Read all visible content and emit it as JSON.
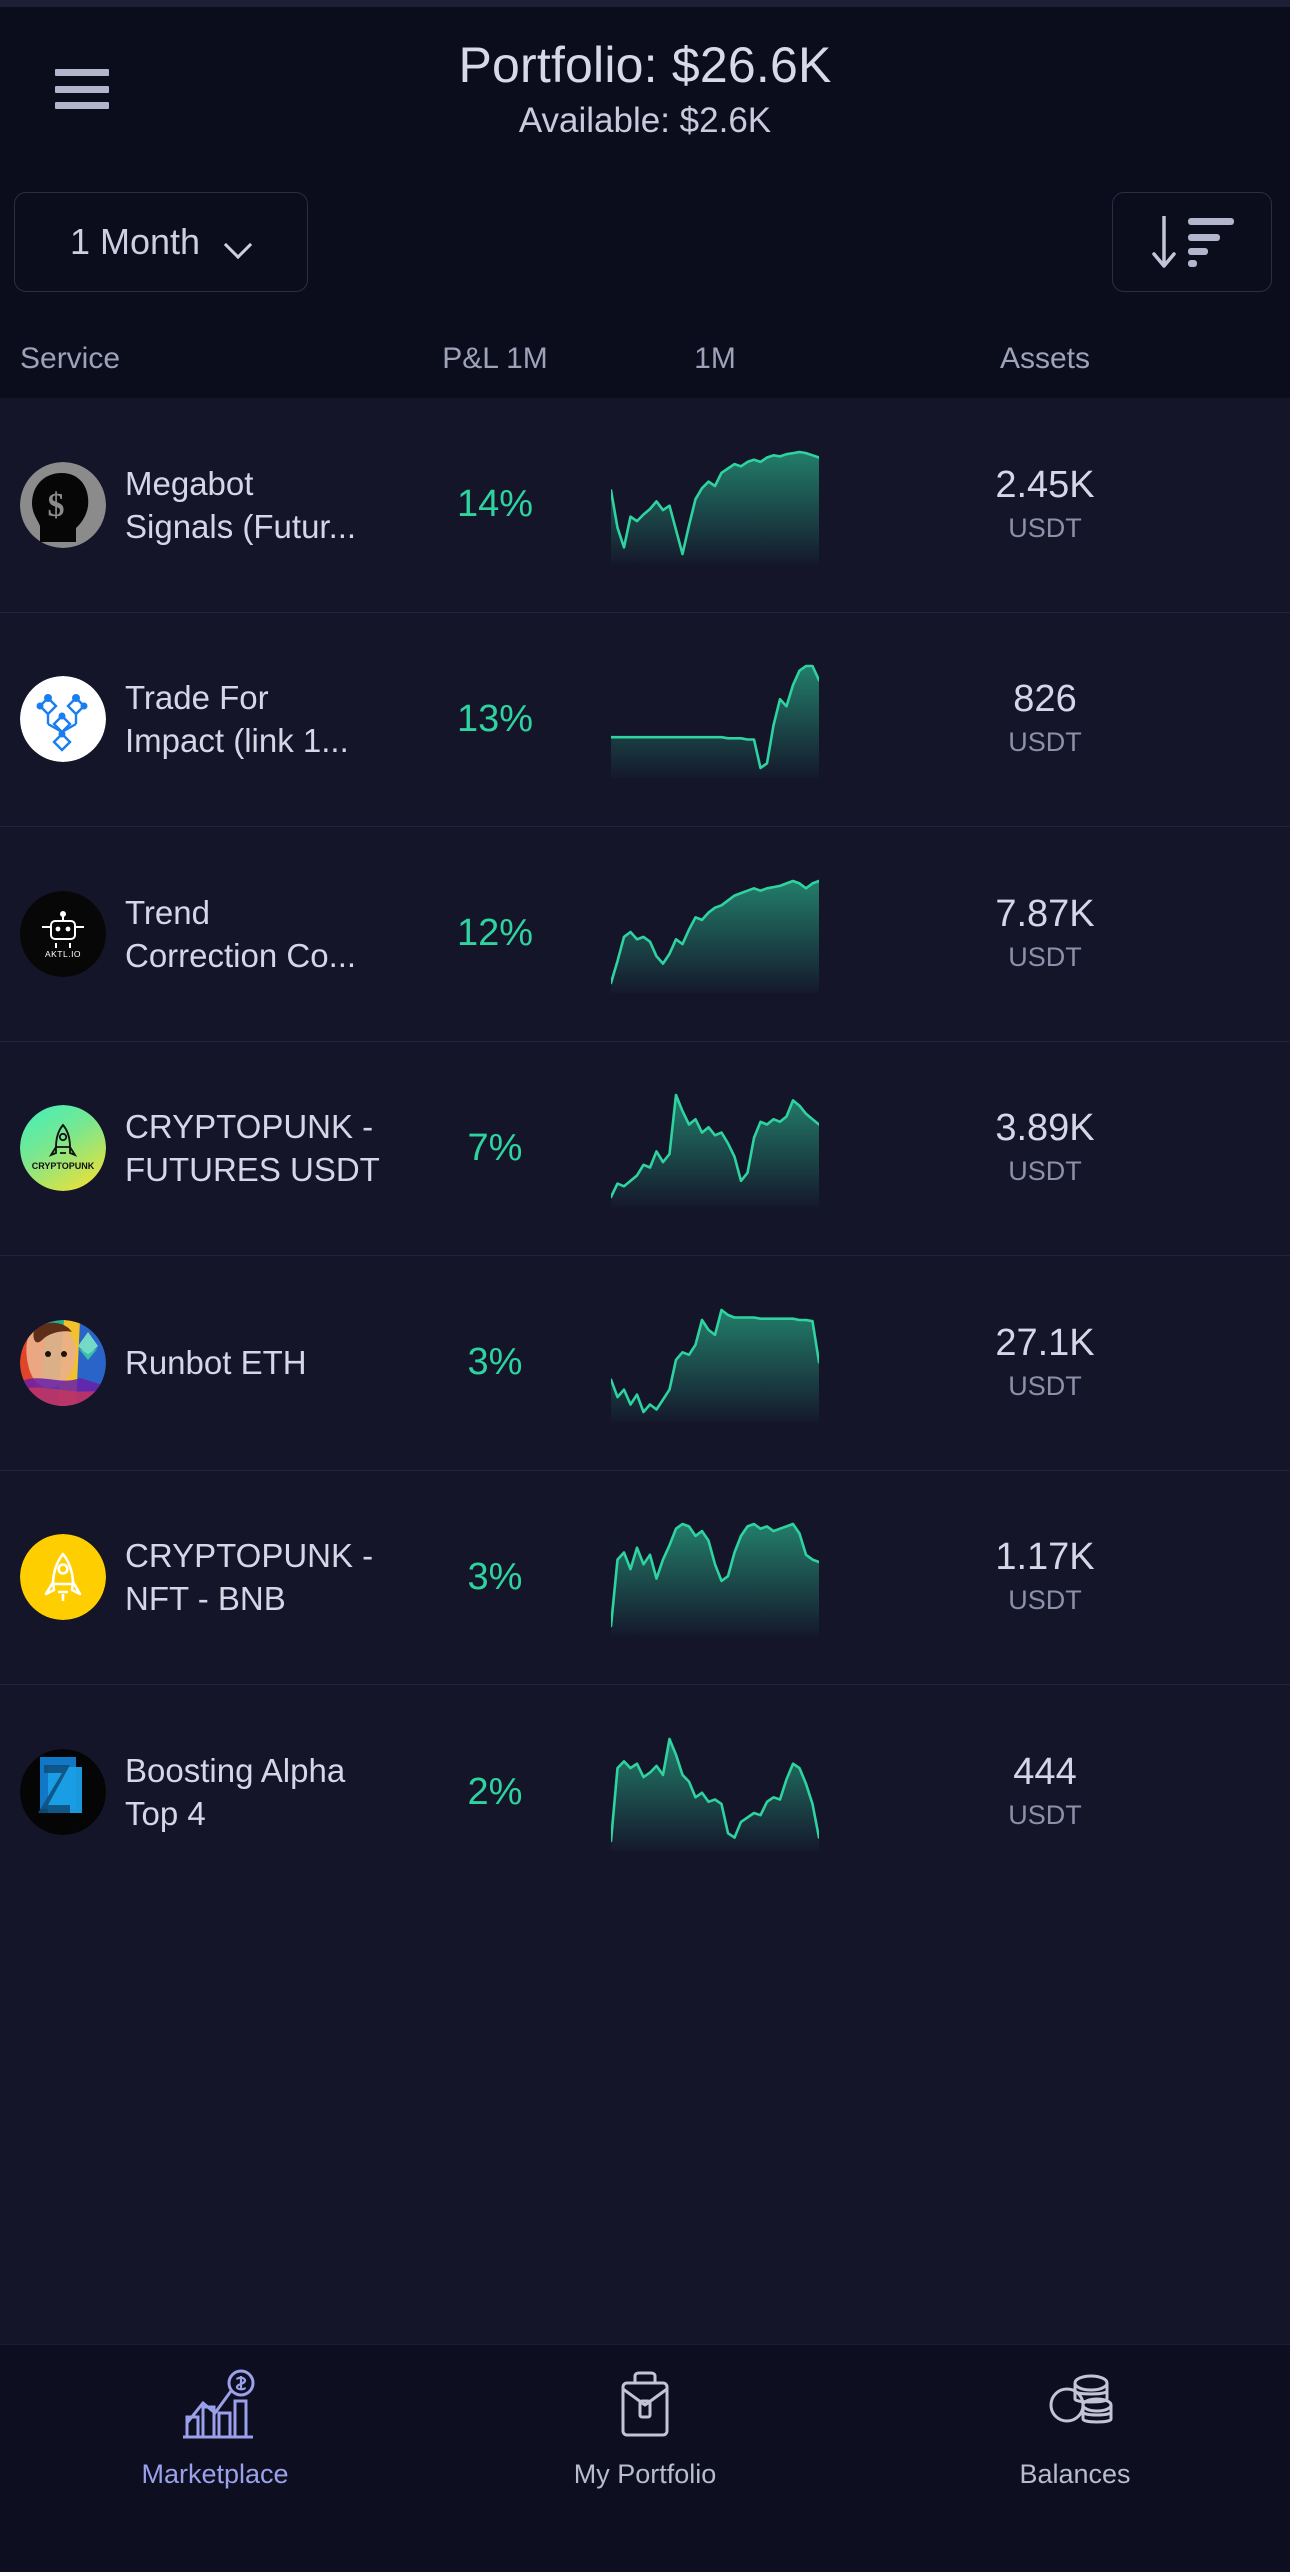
{
  "header": {
    "menu_icon": "hamburger-icon",
    "portfolio_label": "Portfolio: $26.6K",
    "available_label": "Available: $2.6K"
  },
  "controls": {
    "period": {
      "value": "1 Month",
      "chevron_icon": "chevron-down-icon",
      "options": [
        "1 Month"
      ]
    },
    "sort": {
      "icon": "sort-descending-icon",
      "label": ""
    }
  },
  "table": {
    "columns": [
      "Service",
      "P&L 1M",
      "1M",
      "Assets"
    ]
  },
  "colors": {
    "positive": "#2ed3a0",
    "accent": "#9ba0ea",
    "background": "#141529",
    "header_background": "#0b0c1c",
    "text_primary": "#d5d7e6",
    "text_muted": "#8d90a8"
  },
  "rows": [
    {
      "name": "Megabot\nSignals (Futur...",
      "name_lines": [
        "Megabot",
        "Signals (Futur..."
      ],
      "pnl": "14%",
      "assets_value": "2.45K",
      "assets_currency": "USDT",
      "avatar_icon": "dollar-head-icon",
      "avatar_style": "head",
      "sparkline": [
        38,
        72,
        90,
        62,
        66,
        60,
        55,
        48,
        56,
        52,
        74,
        96,
        70,
        46,
        36,
        30,
        34,
        22,
        18,
        14,
        16,
        12,
        10,
        12,
        8,
        6,
        7,
        5,
        4,
        3,
        4,
        6,
        8
      ]
    },
    {
      "name": "Trade For\nImpact (link 1...",
      "name_lines": [
        "Trade For",
        "Impact (link 1..."
      ],
      "pnl": "13%",
      "assets_value": "826",
      "assets_currency": "USDT",
      "avatar_icon": "network-cube-icon",
      "avatar_style": "white",
      "sparkline": [
        62,
        62,
        62,
        62,
        62,
        62,
        62,
        62,
        62,
        62,
        62,
        62,
        62,
        62,
        62,
        62,
        62,
        62,
        63,
        63,
        63,
        64,
        64,
        88,
        84,
        52,
        30,
        36,
        18,
        6,
        2,
        2,
        14
      ]
    },
    {
      "name": "Trend\nCorrection Co...",
      "name_lines": [
        "Trend",
        "Correction Co..."
      ],
      "pnl": "12%",
      "assets_value": "7.87K",
      "assets_currency": "USDT",
      "avatar_icon": "robot-icon",
      "avatar_label": "AKTL.IO",
      "avatar_style": "black",
      "sparkline": [
        88,
        70,
        50,
        46,
        52,
        50,
        54,
        66,
        72,
        64,
        52,
        56,
        44,
        34,
        36,
        30,
        26,
        24,
        20,
        16,
        14,
        12,
        10,
        12,
        10,
        9,
        8,
        6,
        4,
        6,
        10,
        6,
        4
      ]
    },
    {
      "name": "CRYPTOPUNK -\nFUTURES USDT",
      "name_lines": [
        "CRYPTOPUNK -",
        "FUTURES USDT"
      ],
      "pnl": "7%",
      "assets_value": "3.89K",
      "assets_currency": "USDT",
      "avatar_icon": "rocket-icon",
      "avatar_label": "CRYPTOPUNK",
      "avatar_style": "punk",
      "sparkline": [
        82,
        72,
        74,
        70,
        66,
        58,
        60,
        48,
        56,
        50,
        6,
        18,
        28,
        24,
        34,
        30,
        36,
        34,
        42,
        52,
        70,
        64,
        38,
        26,
        28,
        24,
        26,
        22,
        10,
        14,
        20,
        24,
        28
      ]
    },
    {
      "name": "Runbot ETH",
      "name_lines": [
        "Runbot ETH"
      ],
      "pnl": "3%",
      "assets_value": "27.1K",
      "assets_currency": "USDT",
      "avatar_icon": "portrait-eth-icon",
      "avatar_style": "art",
      "sparkline": [
        62,
        76,
        70,
        82,
        74,
        88,
        82,
        86,
        78,
        70,
        46,
        40,
        42,
        34,
        14,
        22,
        26,
        6,
        10,
        12,
        12,
        12,
        12,
        13,
        13,
        13,
        13,
        13,
        13,
        14,
        14,
        15,
        48
      ]
    },
    {
      "name": "CRYPTOPUNK -\nNFT - BNB",
      "name_lines": [
        "CRYPTOPUNK -",
        "NFT - BNB"
      ],
      "pnl": "3%",
      "assets_value": "1.17K",
      "assets_currency": "USDT",
      "avatar_icon": "rocket-icon",
      "avatar_style": "yellow",
      "sparkline": [
        96,
        40,
        34,
        48,
        30,
        44,
        36,
        56,
        40,
        28,
        14,
        10,
        12,
        20,
        16,
        24,
        44,
        58,
        54,
        34,
        20,
        12,
        10,
        14,
        12,
        16,
        14,
        12,
        10,
        18,
        36,
        40,
        42
      ]
    },
    {
      "name": "Boosting Alpha\nTop 4",
      "name_lines": [
        "Boosting Alpha",
        "Top 4"
      ],
      "pnl": "2%",
      "assets_value": "444",
      "assets_currency": "USDT",
      "avatar_icon": "blue-shapes-icon",
      "avatar_style": "blueart",
      "sparkline": [
        95,
        30,
        24,
        30,
        26,
        38,
        34,
        28,
        36,
        4,
        18,
        36,
        42,
        56,
        52,
        60,
        58,
        62,
        88,
        92,
        78,
        74,
        70,
        72,
        60,
        56,
        58,
        40,
        26,
        30,
        44,
        62,
        92
      ]
    }
  ],
  "bottom_nav": [
    {
      "label": "Marketplace",
      "icon": "chart-dollar-icon",
      "active": true
    },
    {
      "label": "My Portfolio",
      "icon": "briefcase-icon",
      "active": false
    },
    {
      "label": "Balances",
      "icon": "coins-icon",
      "active": false
    }
  ]
}
